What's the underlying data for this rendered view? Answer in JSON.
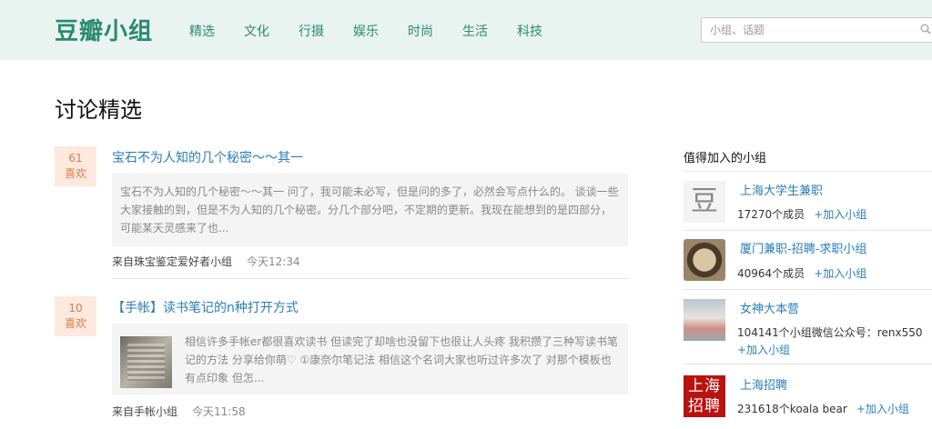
{
  "brand": {
    "logo": "豆瓣小组"
  },
  "nav": [
    {
      "label": "精选"
    },
    {
      "label": "文化"
    },
    {
      "label": "行摄"
    },
    {
      "label": "娱乐"
    },
    {
      "label": "时尚"
    },
    {
      "label": "生活"
    },
    {
      "label": "科技"
    }
  ],
  "search": {
    "placeholder": "小组、话题",
    "value": ""
  },
  "page": {
    "title": "讨论精选"
  },
  "topics": [
    {
      "likes": "61",
      "likes_label": "喜欢",
      "title": "宝石不为人知的几个秘密～～其一",
      "excerpt": "宝石不为人知的几个秘密～～其一 问了，我可能未必写，但是问的多了，必然会写点什么的。 谈谈一些大家接触的到，但是不为人知的几个秘密。分几个部分吧，不定期的更新。我现在能想到的是四部分，可能某天灵感来了也...",
      "group": "来自珠宝鉴定爱好者小组",
      "time": "今天12:34"
    },
    {
      "likes": "10",
      "likes_label": "喜欢",
      "title": "【手帐】读书笔记的n种打开方式",
      "excerpt": "相信许多手帐er都很喜欢读书 但读完了却啥也没留下也很让人头疼 我积攒了三种写读书笔记的方法 分享给你萌♡ ①康奈尔笔记法 相信这个名词大家也听过许多次了 对那个模板也有点印象 但怎...",
      "group": "来自手帐小组",
      "time": "今天11:58"
    }
  ],
  "sidebar": {
    "title": "值得加入的小组",
    "join_label": "+加入小组",
    "groups": [
      {
        "name": "上海大学生兼职",
        "stats": "17270个成员",
        "avatar_text": "豆"
      },
      {
        "name": "厦门兼职-招聘-求职小组",
        "stats": "40964个成员"
      },
      {
        "name": "女神大本营",
        "stats": "104141个小组微信公众号：renx550"
      },
      {
        "name": "上海招聘",
        "stats": "231618个koala bear",
        "avatar_text": "上海 招聘"
      }
    ]
  }
}
